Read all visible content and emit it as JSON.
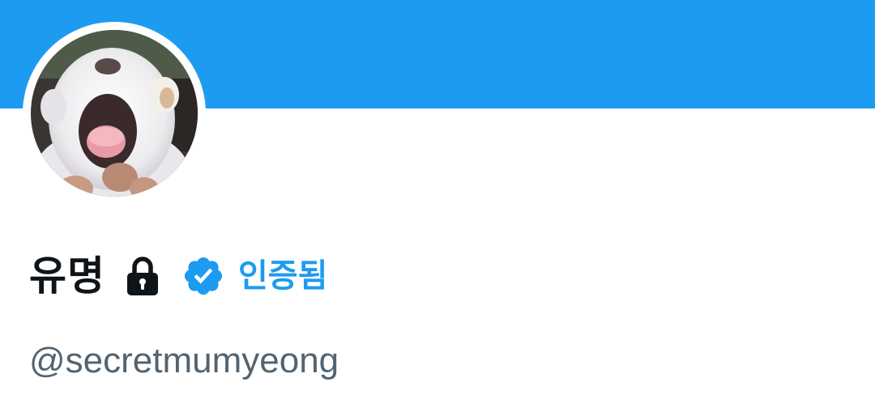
{
  "profile": {
    "display_name": "유명",
    "verified_label": "인증됨",
    "handle": "@secretmumyeong",
    "protected_icon": "lock-icon",
    "verified_icon": "verified-badge-icon",
    "avatar": "profile-avatar"
  },
  "colors": {
    "banner": "#1d9bf0",
    "accent": "#1d9bf0",
    "name": "#0f1419",
    "handle": "#536471"
  }
}
